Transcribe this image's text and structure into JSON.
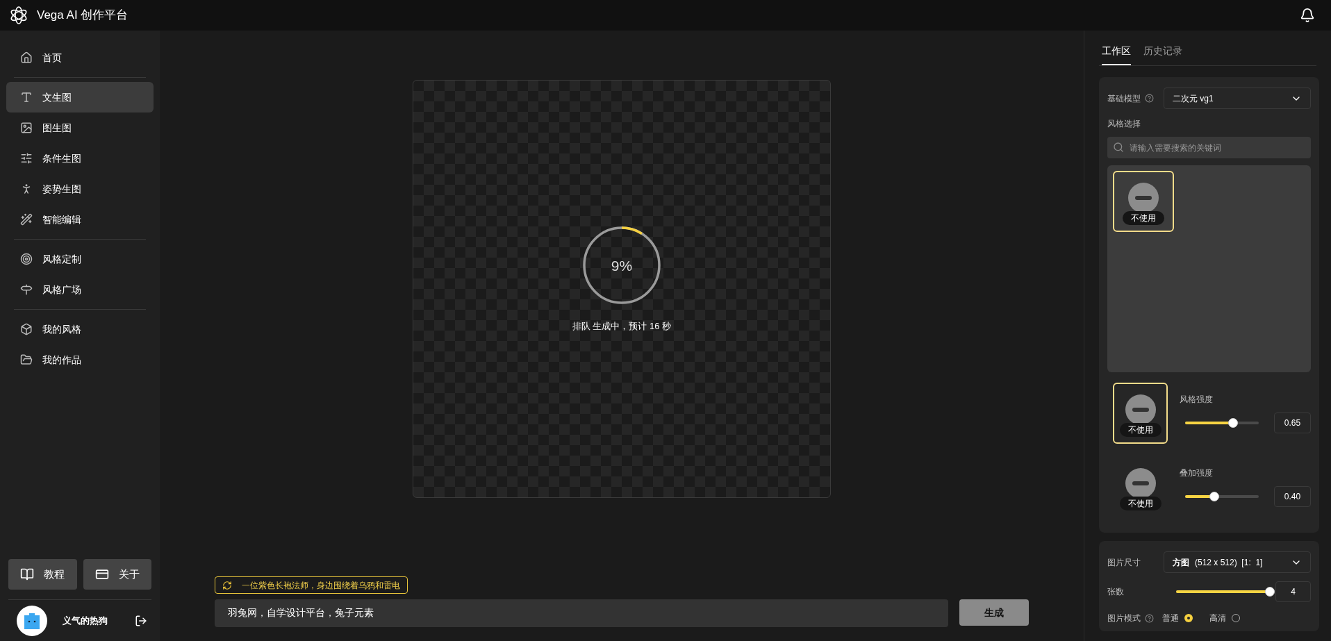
{
  "header": {
    "title": "Vega AI 创作平台"
  },
  "sidebar": {
    "groups": [
      [
        {
          "label": "首页",
          "selected": false
        }
      ],
      [
        {
          "label": "文生图",
          "selected": true
        },
        {
          "label": "图生图",
          "selected": false
        },
        {
          "label": "条件生图",
          "selected": false
        },
        {
          "label": "姿势生图",
          "selected": false
        },
        {
          "label": "智能编辑",
          "selected": false
        }
      ],
      [
        {
          "label": "风格定制",
          "selected": false
        },
        {
          "label": "风格广场",
          "selected": false
        }
      ],
      [
        {
          "label": "我的风格",
          "selected": false
        },
        {
          "label": "我的作品",
          "selected": false
        }
      ]
    ],
    "buttons": [
      "教程",
      "关于"
    ],
    "user": {
      "name": "义气的热狗"
    }
  },
  "canvas": {
    "progress": {
      "label": "9%",
      "level": 0.09
    },
    "status": "排队 生成中，预计 16 秒"
  },
  "prompt": {
    "suggestion": "一位紫色长袍法师，身边围绕着乌鸦和雷电",
    "value": "羽兔网，自学设计平台，兔子元素",
    "button": "生成"
  },
  "panel": {
    "tabs": [
      {
        "label": "工作区",
        "selected": true
      },
      {
        "label": "历史记录",
        "selected": false
      }
    ],
    "model": {
      "label": "基础模型",
      "value": "二次元 vg1"
    },
    "style": {
      "label": "风格选择",
      "placeholder": "请输入需要搜索的关键词",
      "options": [
        {
          "label": "不使用",
          "selected": true
        }
      ]
    },
    "strengths": [
      {
        "style": "不使用",
        "selected": true,
        "label": "风格强度",
        "level": 0.65,
        "value": "0.65"
      },
      {
        "style": "不使用",
        "selected": false,
        "label": "叠加强度",
        "level": 0.4,
        "value": "0.40"
      }
    ],
    "size": {
      "label": "图片尺寸",
      "name": "方图",
      "value": "(512 x 512)  [1:  1]"
    },
    "count": {
      "label": "张数",
      "level": 1,
      "value": "4"
    },
    "mode": {
      "label": "图片模式",
      "options": [
        {
          "label": "普通",
          "selected": true
        },
        {
          "label": "高清",
          "selected": false
        }
      ]
    }
  }
}
